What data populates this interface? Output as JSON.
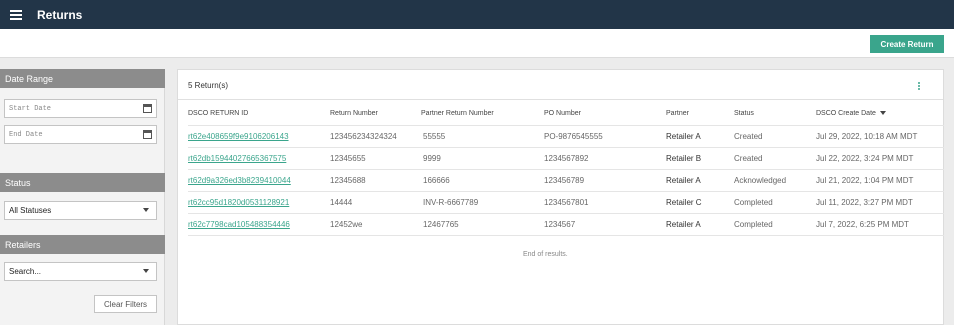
{
  "header": {
    "title": "Returns",
    "create_label": "Create Return"
  },
  "sidebar": {
    "date_range_title": "Date Range",
    "start_placeholder": "Start Date",
    "end_placeholder": "End Date",
    "status_title": "Status",
    "status_value": "All Statuses",
    "retailers_title": "Retailers",
    "retailers_value": "Search...",
    "clear_label": "Clear Filters"
  },
  "main": {
    "count_label": "5 Return(s)",
    "columns": [
      "DSCO RETURN ID",
      "Return Number",
      "Partner Return Number",
      "PO Number",
      "Partner",
      "Status",
      "DSCO Create Date"
    ],
    "rows": [
      [
        "rt62e408659f9e9106206143",
        "123456234324324",
        "55555",
        "PO-9876545555",
        "Retailer A",
        "Created",
        "Jul 29, 2022, 10:18 AM MDT"
      ],
      [
        "rt62db15944027665367575",
        "12345655",
        "9999",
        "1234567892",
        "Retailer B",
        "Created",
        "Jul 22, 2022, 3:24 PM MDT"
      ],
      [
        "rt62d9a326ed3b8239410044",
        "12345688",
        "166666",
        "123456789",
        "Retailer A",
        "Acknowledged",
        "Jul 21, 2022, 1:04 PM MDT"
      ],
      [
        "rt62cc95d1820d0531128921",
        "14444",
        "INV-R-6667789",
        "1234567801",
        "Retailer C",
        "Completed",
        "Jul 11, 2022, 3:27 PM MDT"
      ],
      [
        "rt62c7798cad105488354446",
        "12452we",
        "12467765",
        "1234567",
        "Retailer A",
        "Completed",
        "Jul 7, 2022, 6:25 PM MDT"
      ]
    ],
    "end_text": "End of results."
  }
}
